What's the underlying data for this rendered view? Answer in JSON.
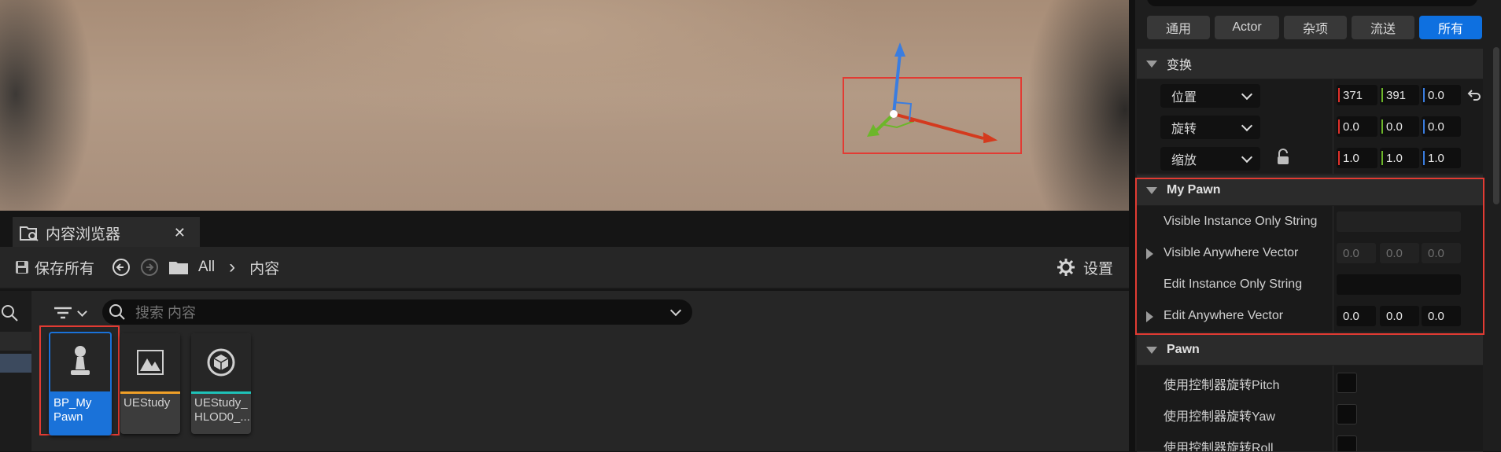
{
  "content_browser": {
    "tab_title": "内容浏览器",
    "tab_close": "✕",
    "save_all": "保存所有",
    "path_root": "All",
    "path_separator": "›",
    "path_current": "内容",
    "settings": "设置",
    "search_placeholder": "搜索 内容",
    "assets": [
      {
        "label": "BP_My Pawn",
        "type": "blueprint",
        "accent": "#1a72d9",
        "icon": "pawn-icon"
      },
      {
        "label": "UEStudy",
        "type": "level",
        "accent": "#f0a028",
        "icon": "map-icon"
      },
      {
        "label": "UEStudy_ HLOD0_...",
        "type": "hlod",
        "accent": "#1fc2b8",
        "icon": "cube-icon"
      }
    ]
  },
  "details": {
    "filter_tabs": [
      "通用",
      "Actor",
      "杂项",
      "流送",
      "所有"
    ],
    "active_filter": "所有",
    "transform": {
      "header": "变换",
      "location": {
        "label": "位置",
        "x": "371",
        "y": "391",
        "z": "0.0"
      },
      "rotation": {
        "label": "旋转",
        "x": "0.0",
        "y": "0.0",
        "z": "0.0"
      },
      "scale": {
        "label": "缩放",
        "x": "1.0",
        "y": "1.0",
        "z": "1.0"
      }
    },
    "my_pawn": {
      "header": "My Pawn",
      "rows": [
        {
          "label": "Visible Instance Only String",
          "value": ""
        },
        {
          "label": "Visible Anywhere Vector",
          "x": "0.0",
          "y": "0.0",
          "z": "0.0"
        },
        {
          "label": "Edit Instance Only String",
          "value": ""
        },
        {
          "label": "Edit Anywhere Vector",
          "x": "0.0",
          "y": "0.0",
          "z": "0.0"
        }
      ]
    },
    "pawn": {
      "header": "Pawn",
      "rows": [
        {
          "label": "使用控制器旋转Pitch"
        },
        {
          "label": "使用控制器旋转Yaw"
        },
        {
          "label": "使用控制器旋转Roll"
        }
      ]
    }
  },
  "colors": {
    "accent": "#0e70e0",
    "highlight": "#e23b33",
    "axis_x": "#e0302a",
    "axis_y": "#6cb62a",
    "axis_z": "#3a7de0"
  }
}
